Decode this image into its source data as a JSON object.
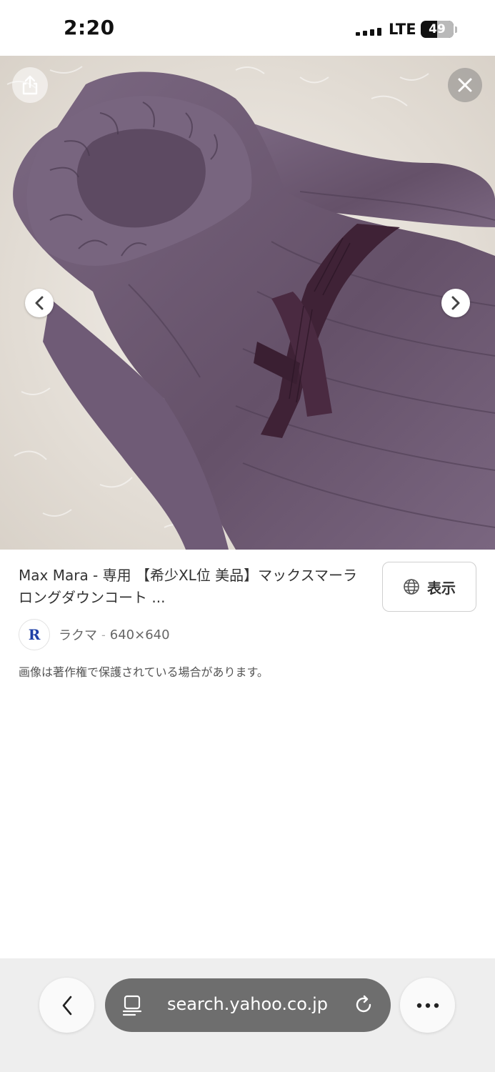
{
  "status_bar": {
    "time": "2:20",
    "network": "LTE",
    "battery_percent": "49",
    "battery_level": 0.49
  },
  "viewer": {
    "share_icon": "share-icon",
    "close_icon": "close-icon",
    "prev_icon": "chevron-left-icon",
    "next_icon": "chevron-right-icon",
    "image_subject": "purple quilted down coat with belt"
  },
  "result": {
    "title": "Max Mara - 専用 【希少XL位 美品】マックスマーラ ロングダウンコート ...",
    "view_button": {
      "label": "表示",
      "icon": "globe-icon"
    },
    "source": {
      "logo_letter": "R",
      "name": "ラクマ",
      "separator": "-",
      "size": "640×640"
    },
    "copyright_notice": "画像は著作権で保護されている場合があります。"
  },
  "toolbar": {
    "back_icon": "chevron-left-icon",
    "reader_icon": "page-menu-icon",
    "url": "search.yahoo.co.jp",
    "reload_icon": "reload-icon",
    "more_icon": "ellipsis-icon"
  },
  "colors": {
    "coat": "#6e5a75",
    "belt": "#3f2236",
    "fur_background": "#ebe6df",
    "address_bar": "#6e6e6e",
    "accent_logo": "#1e3fa6"
  }
}
